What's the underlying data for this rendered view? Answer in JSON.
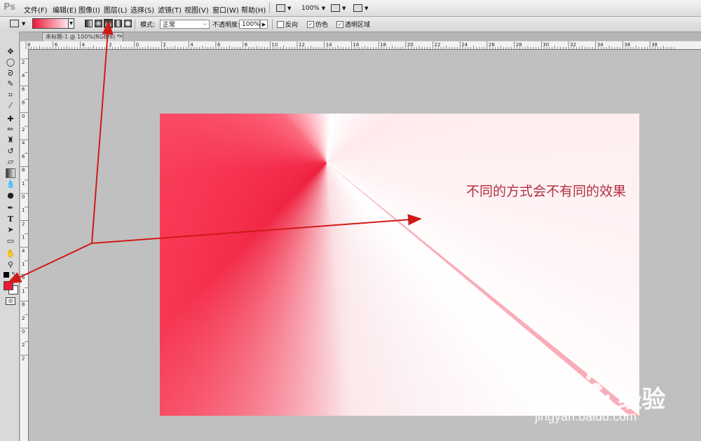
{
  "app": {
    "logo": "Ps"
  },
  "menubar": {
    "items": [
      "文件(F)",
      "编辑(E)",
      "图像(I)",
      "图层(L)",
      "选择(S)",
      "滤镜(T)",
      "视图(V)",
      "窗口(W)",
      "帮助(H)"
    ],
    "zoom": "100%"
  },
  "options": {
    "gradient_start_color": "#ec1a3a",
    "gradient_end_color": "#ffffff",
    "gradient_types": [
      "linear",
      "radial",
      "angle",
      "reflected",
      "diamond"
    ],
    "active_gradient_type": "angle",
    "mode_label": "模式:",
    "mode_value": "正常",
    "opacity_label": "不透明度:",
    "opacity_value": "100%",
    "reverse_label": "反向",
    "reverse_checked": false,
    "dither_label": "仿色",
    "dither_checked": true,
    "transparency_label": "透明区域",
    "transparency_checked": true
  },
  "document": {
    "tab_title": "未标题-1 @ 100%(RGB/8) *",
    "close_glyph": "×"
  },
  "rulers": {
    "h_labels": [
      "8",
      "6",
      "4",
      "2",
      "0",
      "2",
      "4",
      "6",
      "8",
      "10",
      "12",
      "14",
      "16",
      "18",
      "20",
      "22",
      "24",
      "26",
      "28",
      "30",
      "32",
      "34",
      "36",
      "38"
    ],
    "v_labels": [
      "2",
      "4",
      "6",
      "8",
      "0",
      "2",
      "4",
      "6",
      "8",
      "1",
      "0",
      "1",
      "2",
      "1",
      "4",
      "1",
      "6",
      "1",
      "8",
      "2",
      "0",
      "2",
      "2"
    ]
  },
  "tools": [
    "move",
    "marquee",
    "lasso",
    "quick-select",
    "crop",
    "eyedropper",
    "healing",
    "brush",
    "stamp",
    "history-brush",
    "eraser",
    "gradient",
    "blur",
    "dodge",
    "pen",
    "type",
    "path-select",
    "shape",
    "hand",
    "zoom"
  ],
  "colors": {
    "foreground": "#ec1a3a",
    "background": "#ffffff"
  },
  "canvas": {
    "text": "不同的方式会不有同的效果"
  },
  "watermark": {
    "logo_text": "Bai du 经验",
    "url": "jingyan.baidu.com"
  }
}
